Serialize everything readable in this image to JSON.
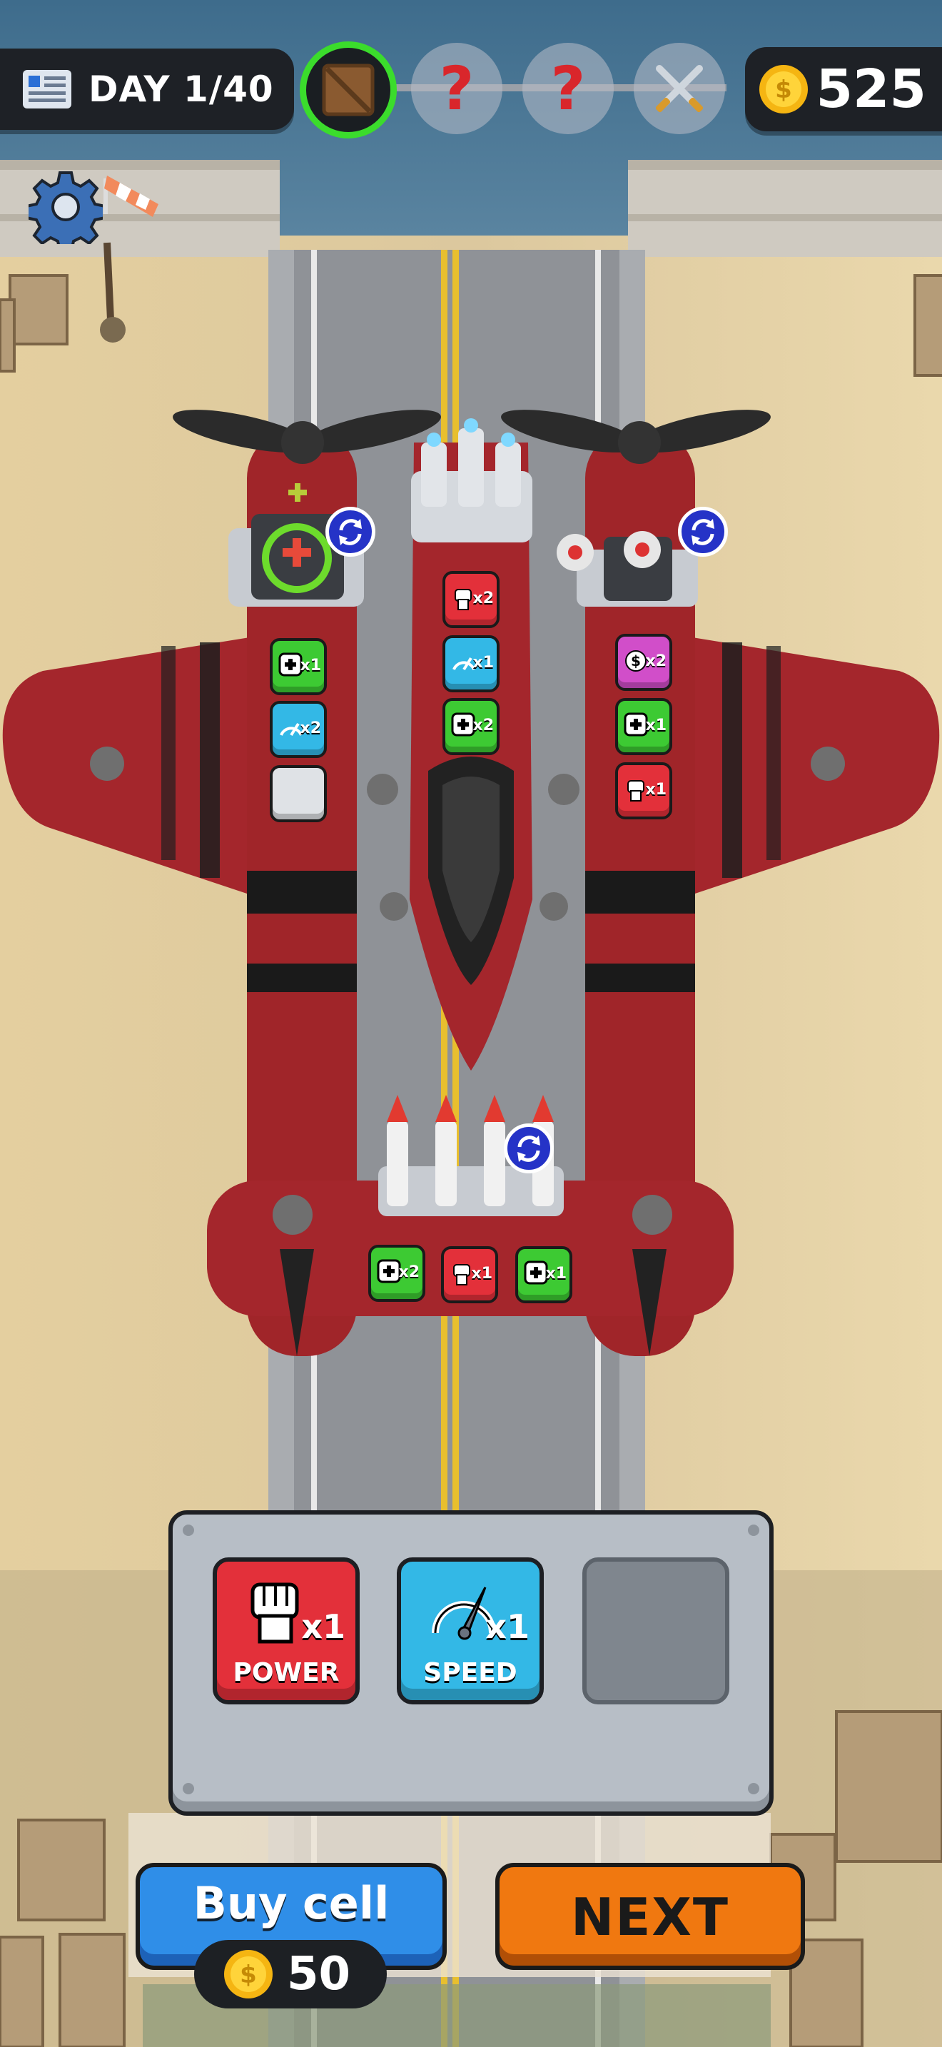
{
  "hud": {
    "day_label": "DAY 1/40",
    "coins": "525",
    "progress_nodes": [
      {
        "kind": "crate",
        "state": "current"
      },
      {
        "kind": "unknown",
        "symbol": "?"
      },
      {
        "kind": "unknown",
        "symbol": "?"
      },
      {
        "kind": "battle",
        "icon": "crossed-swords-icon"
      }
    ],
    "accent_green": "#3bdc2c"
  },
  "plane": {
    "color": "#a4262c",
    "left_module": {
      "weapon": "healing-turret",
      "cells": [
        {
          "type": "heal",
          "mult": "x1",
          "color": "green"
        },
        {
          "type": "speed",
          "mult": "x2",
          "color": "blue"
        },
        {
          "type": "empty",
          "mult": "",
          "color": "empty"
        }
      ]
    },
    "center_module": {
      "weapon": "tesla-turret",
      "cells": [
        {
          "type": "power",
          "mult": "x2",
          "color": "red"
        },
        {
          "type": "speed",
          "mult": "x1",
          "color": "blue"
        },
        {
          "type": "heal",
          "mult": "x2",
          "color": "green"
        }
      ]
    },
    "right_module": {
      "weapon": "drone-turret",
      "cells": [
        {
          "type": "money",
          "mult": "x2",
          "color": "purple"
        },
        {
          "type": "heal",
          "mult": "x1",
          "color": "green"
        },
        {
          "type": "power",
          "mult": "x1",
          "color": "red"
        }
      ]
    },
    "tail_module": {
      "weapon": "missile-rack",
      "cells": [
        {
          "type": "heal",
          "mult": "x2",
          "color": "green"
        },
        {
          "type": "power",
          "mult": "x1",
          "color": "red"
        },
        {
          "type": "heal",
          "mult": "x1",
          "color": "green"
        }
      ]
    }
  },
  "inventory": {
    "slots": [
      {
        "label": "POWER",
        "mult": "x1",
        "color": "#e3303a",
        "icon": "fist-icon"
      },
      {
        "label": "SPEED",
        "mult": "x1",
        "color": "#33b8e6",
        "icon": "speedometer-icon"
      },
      {
        "label": "",
        "mult": "",
        "color": "#7f868e",
        "icon": ""
      }
    ]
  },
  "buttons": {
    "buy_label": "Buy cell",
    "buy_price": "50",
    "next_label": "NEXT"
  }
}
